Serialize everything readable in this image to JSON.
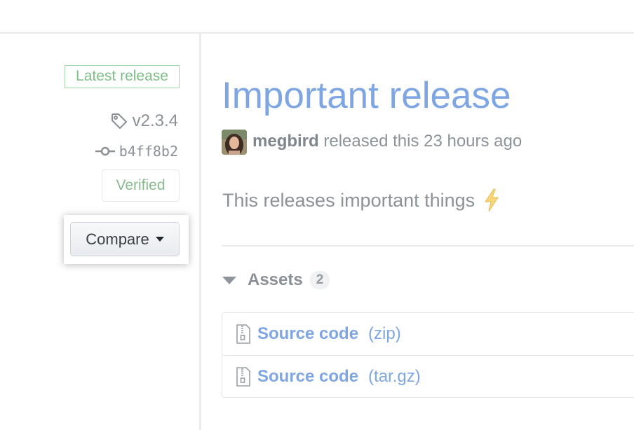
{
  "sidebar": {
    "latest_badge": "Latest release",
    "tag": "v2.3.4",
    "commit": "b4ff8b2",
    "verified_badge": "Verified",
    "compare_label": "Compare",
    "icons": [
      "tag-icon",
      "git-commit-icon",
      "triangle-down-icon"
    ]
  },
  "release": {
    "title": "Important release",
    "author": "megbird",
    "released_text": "released this 23 hours ago",
    "body": "This releases important things",
    "body_emoji": "zap-icon"
  },
  "assets": {
    "label": "Assets",
    "count": "2",
    "items": [
      {
        "name": "Source code",
        "ext": "(zip)",
        "icon": "file-zip-icon"
      },
      {
        "name": "Source code",
        "ext": "(tar.gz)",
        "icon": "file-zip-icon"
      }
    ]
  },
  "colors": {
    "link": "#7fa6e4",
    "success": "#7fbf88",
    "muted_text": "#8d939a"
  }
}
